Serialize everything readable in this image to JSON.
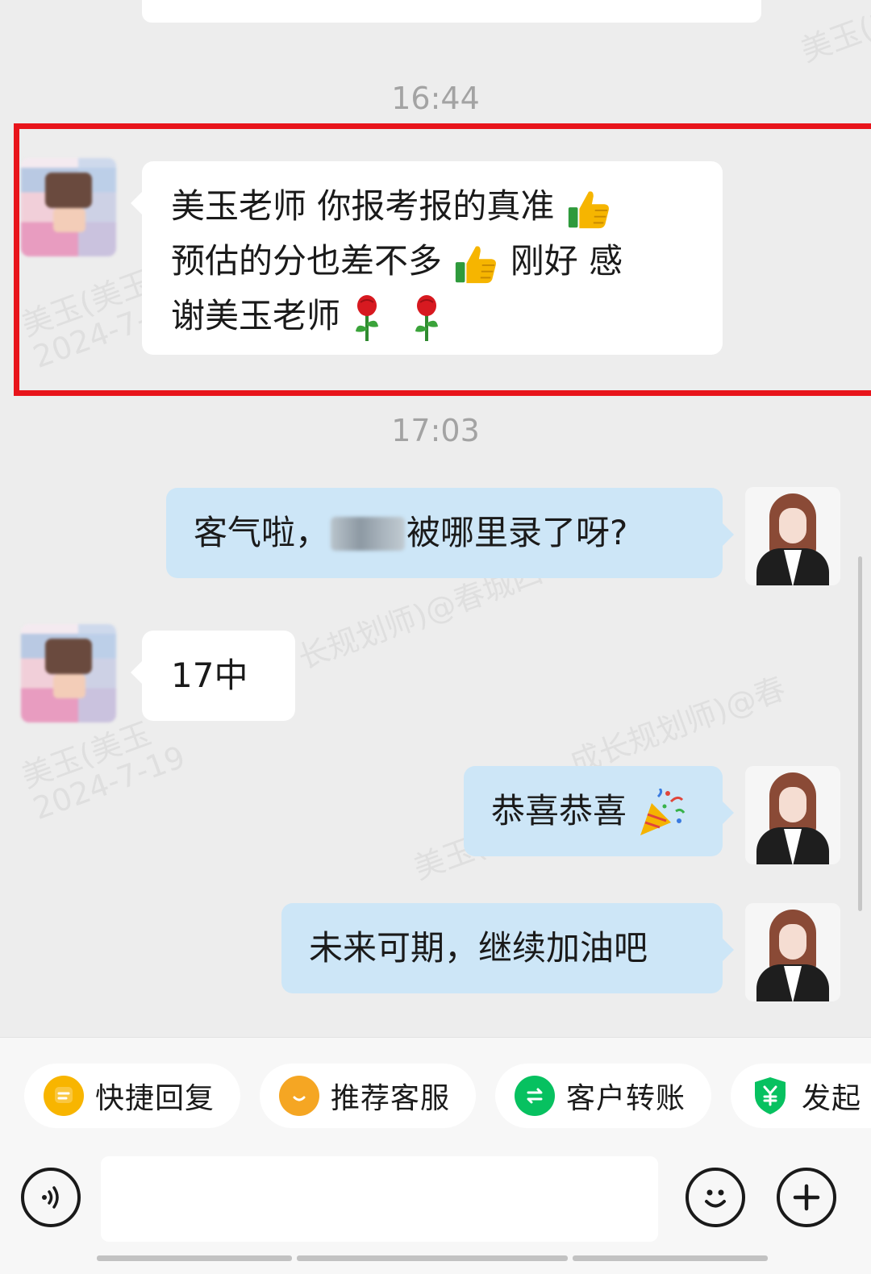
{
  "timestamps": [
    "16:44",
    "17:03"
  ],
  "messages": [
    {
      "sender": "customer",
      "line1": "美玉老师 你报考报的真准",
      "line2": "预估的分也差不多",
      "line2b": "刚好 感",
      "line3": "谢美玉老师",
      "emojis": [
        "thumbs-up",
        "thumbs-up",
        "rose",
        "rose"
      ]
    },
    {
      "sender": "agent",
      "prefix": "客气啦，",
      "suffix": "被哪里录了呀?"
    },
    {
      "sender": "customer",
      "text": "17中"
    },
    {
      "sender": "agent",
      "text": "恭喜恭喜",
      "emojis": [
        "party-popper"
      ]
    },
    {
      "sender": "agent",
      "text": "未来可期，继续加油吧"
    }
  ],
  "watermarks": [
    "美玉(美玉",
    "2024-7-19",
    "长规划师)@春城四叶草",
    "成长规划师)@春"
  ],
  "quick_actions": [
    {
      "label": "快捷回复",
      "icon": "quick-reply-icon",
      "color": "#f8b500"
    },
    {
      "label": "推荐客服",
      "icon": "recommend-agent-icon",
      "color": "#f5a623"
    },
    {
      "label": "客户转账",
      "icon": "transfer-icon",
      "color": "#07c160"
    },
    {
      "label": "发起",
      "icon": "shield-yuan-icon",
      "color": "#07c160"
    }
  ],
  "input": {
    "placeholder": "",
    "value": ""
  },
  "colors": {
    "highlight": "#e8141b",
    "outgoing_bubble": "#cde6f7",
    "background": "#ededed"
  }
}
